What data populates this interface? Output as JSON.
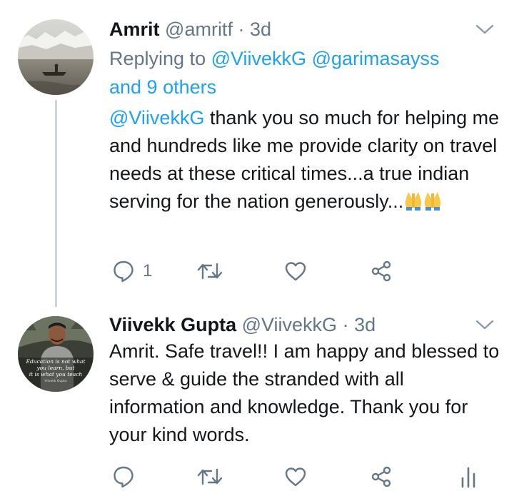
{
  "tweets": [
    {
      "name": "Amrit",
      "handle": "@amritf",
      "dot": "·",
      "time": "3d",
      "replying_prefix": "Replying to ",
      "replying_user_1": "@ViivekkG",
      "replying_user_2": "@garimasayss",
      "replying_suffix": "and 9 others",
      "mention": "@ViivekkG",
      "text": " thank you so much for helping me and hundreds like me provide clarity on travel needs at these critical times...a true indian serving for the nation generously...",
      "emoji": [
        "folded-hands",
        "folded-hands"
      ],
      "reply_count": "1",
      "avatar": "landscape-boat-photo"
    },
    {
      "name": "Viivekk Gupta",
      "handle": "@ViivekkG",
      "dot": "·",
      "time": "3d",
      "text": "Amrit. Safe travel!! I am happy and blessed to serve & guide the stranded with all information and knowledge. Thank you for your kind words.",
      "reply_count": "",
      "avatar": "profile-quote-photo",
      "avatar_text_1": "Education is not what",
      "avatar_text_2": "you learn, but",
      "avatar_text_3": "it is what you teach",
      "avatar_text_4": "Viivekk Gupta"
    }
  ],
  "colors": {
    "link": "#1da1f2",
    "secondary": "#657786",
    "primary": "#14171a",
    "thread_line": "#ccd6dd"
  },
  "icons": [
    "reply-icon",
    "retweet-icon",
    "like-icon",
    "share-icon",
    "analytics-icon",
    "chevron-down-icon"
  ]
}
